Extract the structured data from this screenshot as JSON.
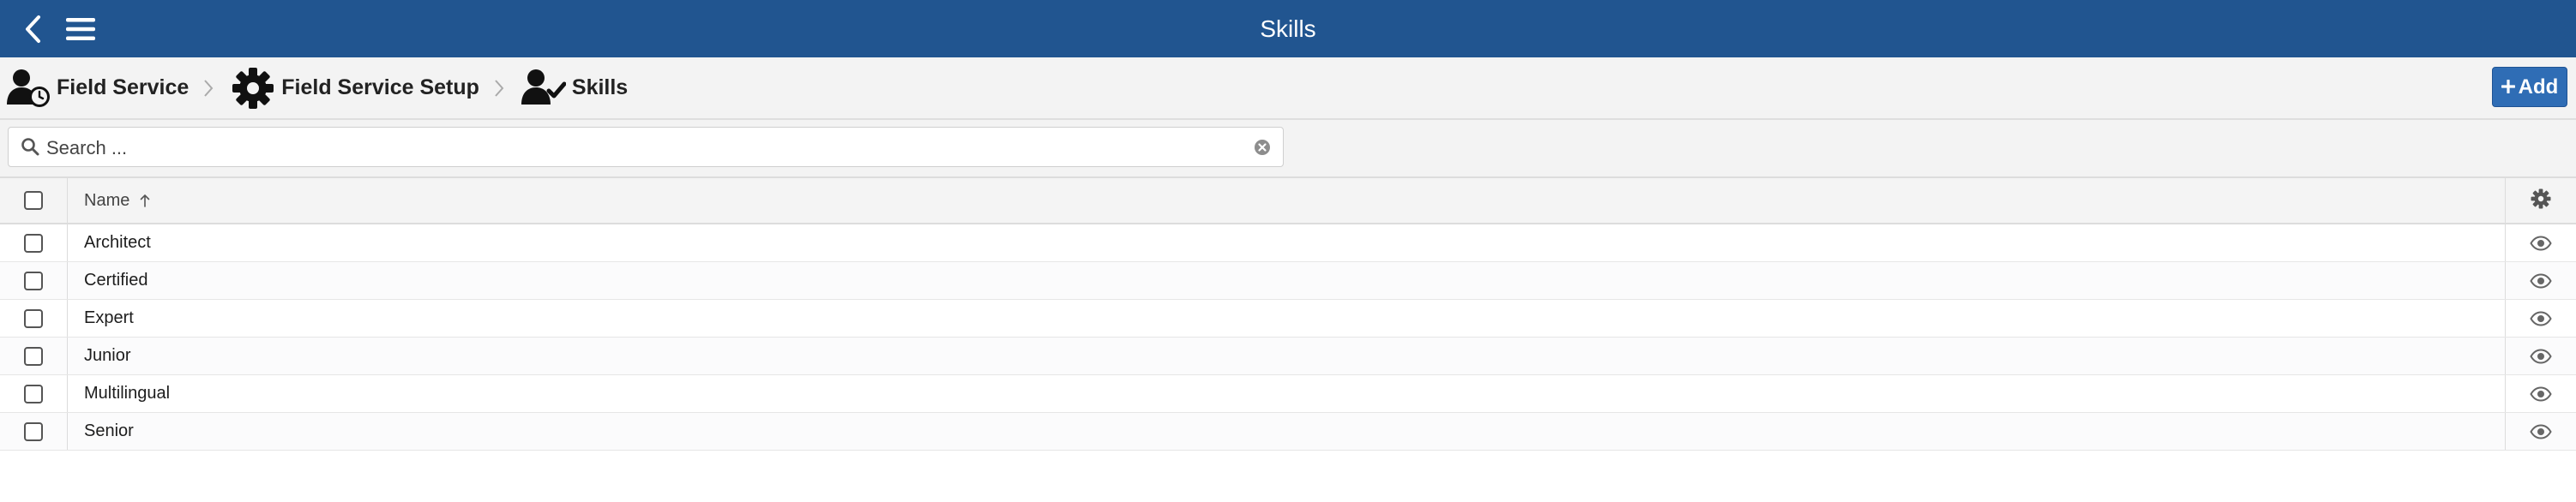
{
  "header": {
    "title": "Skills",
    "back_icon": "chevron-left-icon",
    "menu_icon": "hamburger-icon",
    "color": "#215590"
  },
  "breadcrumb": [
    {
      "label": "Field Service",
      "icon": "user-clock-icon"
    },
    {
      "label": "Field Service Setup",
      "icon": "gear-icon"
    },
    {
      "label": "Skills",
      "icon": "user-check-icon"
    }
  ],
  "toolbar": {
    "add_label": "Add",
    "add_icon": "plus-icon",
    "add_color": "#2f6db5"
  },
  "search": {
    "placeholder": "Search ...",
    "value": ""
  },
  "table": {
    "columns": [
      {
        "label": "Name",
        "sort": "ascending"
      }
    ],
    "settings_icon": "gear-icon",
    "row_action_icon": "eye-icon",
    "rows": [
      {
        "name": "Architect"
      },
      {
        "name": "Certified"
      },
      {
        "name": "Expert"
      },
      {
        "name": "Junior"
      },
      {
        "name": "Multilingual"
      },
      {
        "name": "Senior"
      }
    ]
  }
}
